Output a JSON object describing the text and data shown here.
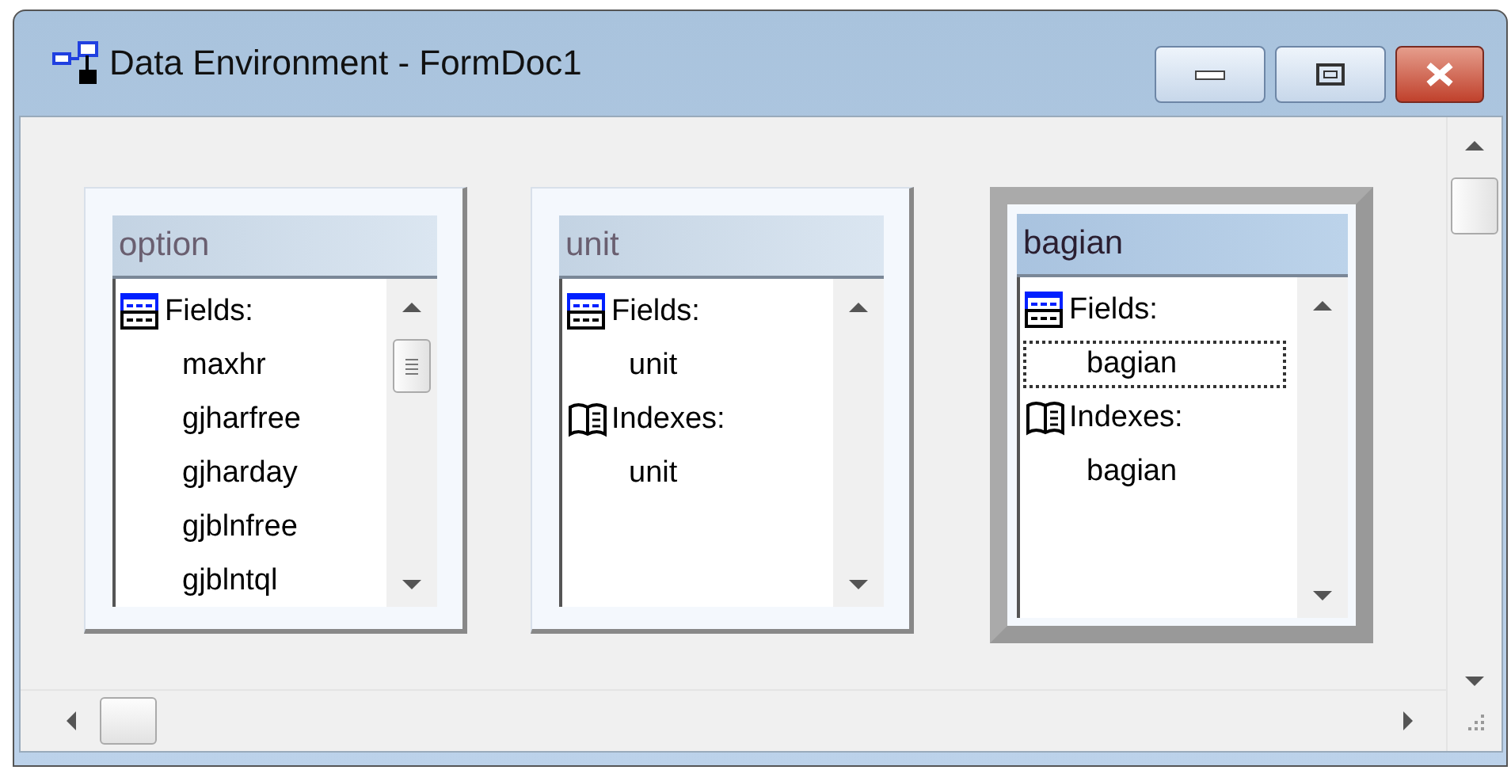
{
  "window": {
    "title": "Data Environment - FormDoc1"
  },
  "tables": [
    {
      "name": "option",
      "selected": false,
      "scrollable": true,
      "items": [
        {
          "kind": "fields_header",
          "text": "Fields:"
        },
        {
          "kind": "item",
          "text": "maxhr",
          "focused": false
        },
        {
          "kind": "item",
          "text": "gjharfree",
          "focused": false
        },
        {
          "kind": "item",
          "text": "gjharday",
          "focused": false
        },
        {
          "kind": "item",
          "text": "gjblnfree",
          "focused": false
        },
        {
          "kind": "item",
          "text": "gjblntql",
          "focused": false
        }
      ]
    },
    {
      "name": "unit",
      "selected": false,
      "scrollable": false,
      "items": [
        {
          "kind": "fields_header",
          "text": "Fields:"
        },
        {
          "kind": "item",
          "text": "unit",
          "focused": false
        },
        {
          "kind": "indexes_header",
          "text": "Indexes:"
        },
        {
          "kind": "item",
          "text": "unit",
          "focused": false
        }
      ]
    },
    {
      "name": "bagian",
      "selected": true,
      "scrollable": false,
      "items": [
        {
          "kind": "fields_header",
          "text": "Fields:"
        },
        {
          "kind": "item",
          "text": "bagian",
          "focused": true
        },
        {
          "kind": "indexes_header",
          "text": "Indexes:"
        },
        {
          "kind": "item",
          "text": "bagian",
          "focused": false
        }
      ]
    }
  ]
}
